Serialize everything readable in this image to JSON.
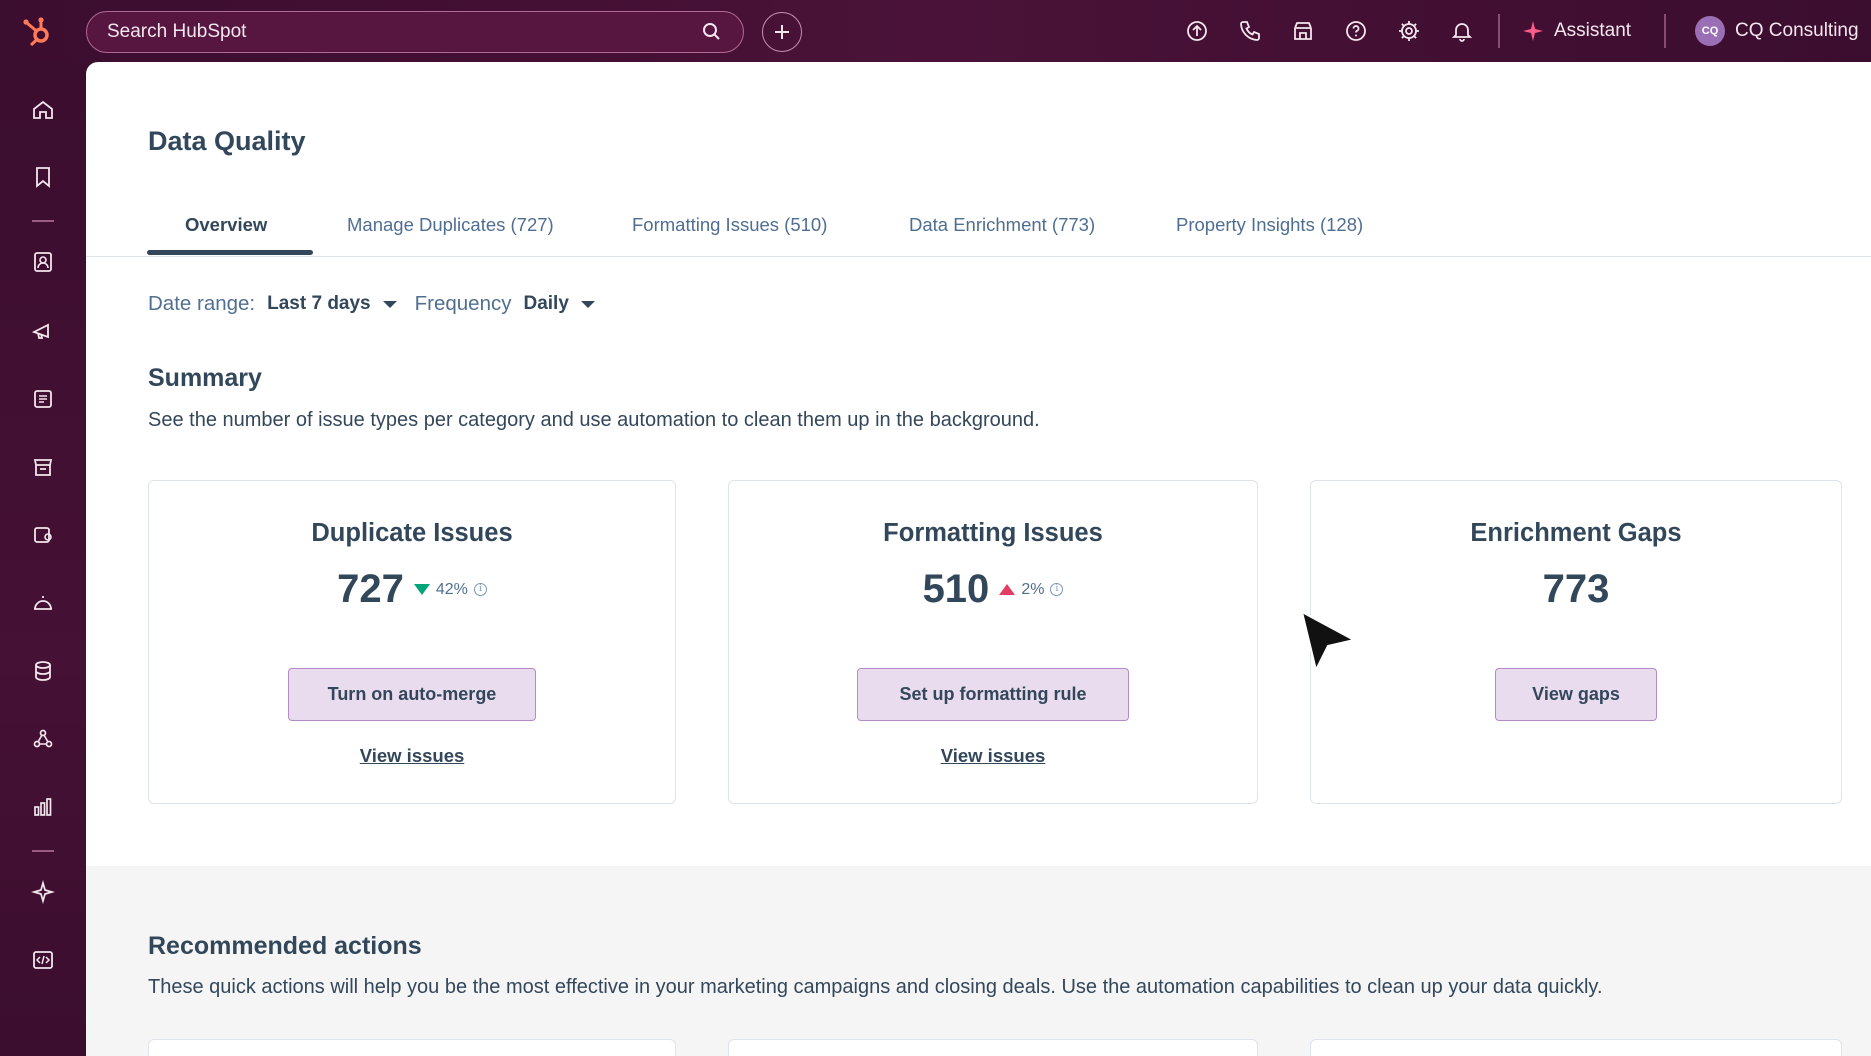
{
  "topbar": {
    "search_placeholder": "Search HubSpot",
    "assistant_label": "Assistant",
    "account_initials": "CQ",
    "account_name": "CQ Consulting"
  },
  "page": {
    "title": "Data Quality",
    "tabs": [
      {
        "label": "Overview",
        "active": true
      },
      {
        "label": "Manage Duplicates (727)"
      },
      {
        "label": "Formatting Issues (510)"
      },
      {
        "label": "Data Enrichment (773)"
      },
      {
        "label": "Property Insights (128)"
      }
    ],
    "filters": {
      "date_label": "Date range:",
      "date_value": "Last 7 days",
      "freq_label": "Frequency",
      "freq_value": "Daily"
    },
    "summary": {
      "title": "Summary",
      "description": "See the number of issue types per category and use automation to clean them up in the background."
    },
    "cards": [
      {
        "title": "Duplicate Issues",
        "value": "727",
        "trend": "42%",
        "trend_dir": "down",
        "button": "Turn on auto-merge",
        "link": "View issues"
      },
      {
        "title": "Formatting Issues",
        "value": "510",
        "trend": "2%",
        "trend_dir": "up",
        "button": "Set up formatting rule",
        "link": "View issues"
      },
      {
        "title": "Enrichment Gaps",
        "value": "773",
        "button": "View gaps"
      }
    ],
    "recommended": {
      "title": "Recommended actions",
      "description": "These quick actions will help you be the most effective in your marketing campaigns and closing deals. Use the automation capabilities to clean up your data quickly."
    }
  },
  "colors": {
    "nav_bg": "#3b0d2e",
    "button_bg": "#eadcef",
    "trend_down": "#00a47b",
    "trend_up": "#e43d63",
    "text": "#33475b"
  }
}
